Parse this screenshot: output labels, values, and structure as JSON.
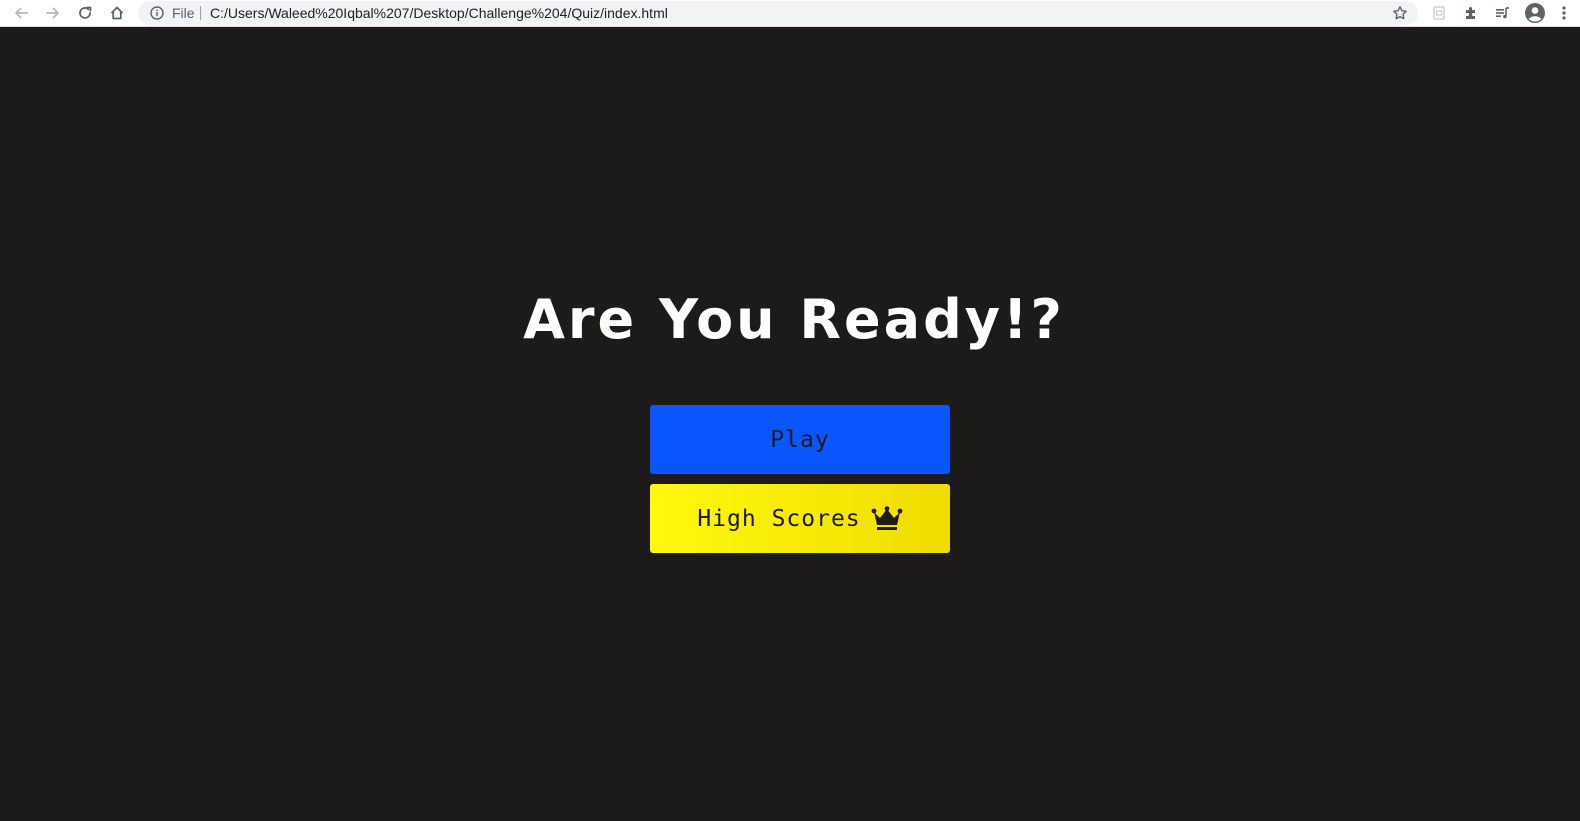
{
  "browser": {
    "scheme_label": "File",
    "url": "C:/Users/Waleed%20Iqbal%207/Desktop/Challenge%204/Quiz/index.html"
  },
  "page": {
    "title": "Are You Ready!?",
    "play_label": "Play",
    "high_scores_label": "High Scores"
  },
  "icons": {
    "back": "back-arrow-icon",
    "forward": "forward-arrow-icon",
    "reload": "reload-icon",
    "home": "home-icon",
    "info": "info-icon",
    "bookmark": "star-icon",
    "extension_page": "page-icon",
    "extensions": "puzzle-icon",
    "media": "media-queue-icon",
    "profile": "account-icon",
    "menu": "kebab-menu-icon",
    "crown": "crown-icon"
  },
  "colors": {
    "page_background": "#1c1b1a",
    "title": "#ffffff",
    "play_button": "#0a57ff",
    "high_scores_button_start": "#fff90c",
    "high_scores_button_end": "#f0dc00"
  }
}
